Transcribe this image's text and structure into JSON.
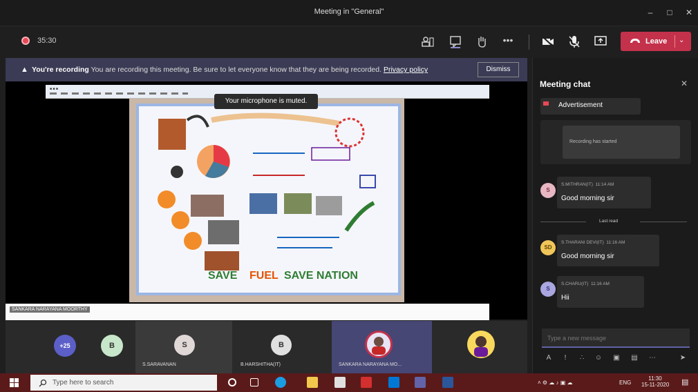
{
  "window": {
    "title": "Meeting in \"General\""
  },
  "toolbar": {
    "timer": "35:30",
    "leave_label": "Leave"
  },
  "banner": {
    "title": "You're recording",
    "message": "You are recording this meeting. Be sure to let everyone know that they are being recorded.",
    "link": "Privacy policy",
    "dismiss": "Dismiss"
  },
  "video": {
    "toast": "Your microphone is muted.",
    "speaker": "SANKARA NARAYANA MOORTHY"
  },
  "participants": [
    {
      "label": "+25"
    },
    {
      "label": "B"
    },
    {
      "initial": "S",
      "name": "S.SARAVANAN"
    },
    {
      "initial": "B",
      "name": "B.HARSHITHA(IT)"
    },
    {
      "name": "SANKARA NARAYANA MO..."
    }
  ],
  "chat": {
    "title": "Meeting chat",
    "items": [
      {
        "type": "card",
        "text": "Advertisement"
      },
      {
        "type": "system",
        "text": "Recording has started"
      },
      {
        "initials": "S",
        "sender": "S.MITHRAN(IT)",
        "time": "11:14 AM",
        "text": "Good morning sir",
        "avatar_color": "#e8b7c4"
      },
      {
        "type": "divider",
        "text": "Last read"
      },
      {
        "initials": "SD",
        "sender": "S.THARANI DEVI(IT)",
        "time": "11:16 AM",
        "text": "Good morning sir",
        "avatar_color": "#f0c65a"
      },
      {
        "initials": "S",
        "sender": "S.CHARU(IT)",
        "time": "11:16 AM",
        "text": "Hii",
        "avatar_color": "#a9a6e0"
      }
    ],
    "input_placeholder": "Type a new message"
  },
  "taskbar": {
    "search_placeholder": "Type here to search",
    "language": "ENG",
    "time": "11:30",
    "date": "15-11-2020"
  },
  "colors": {
    "leave": "#c4314b",
    "banner": "#3b3b55",
    "accent": "#6264a7",
    "taskbar": "#5b1a1a"
  }
}
